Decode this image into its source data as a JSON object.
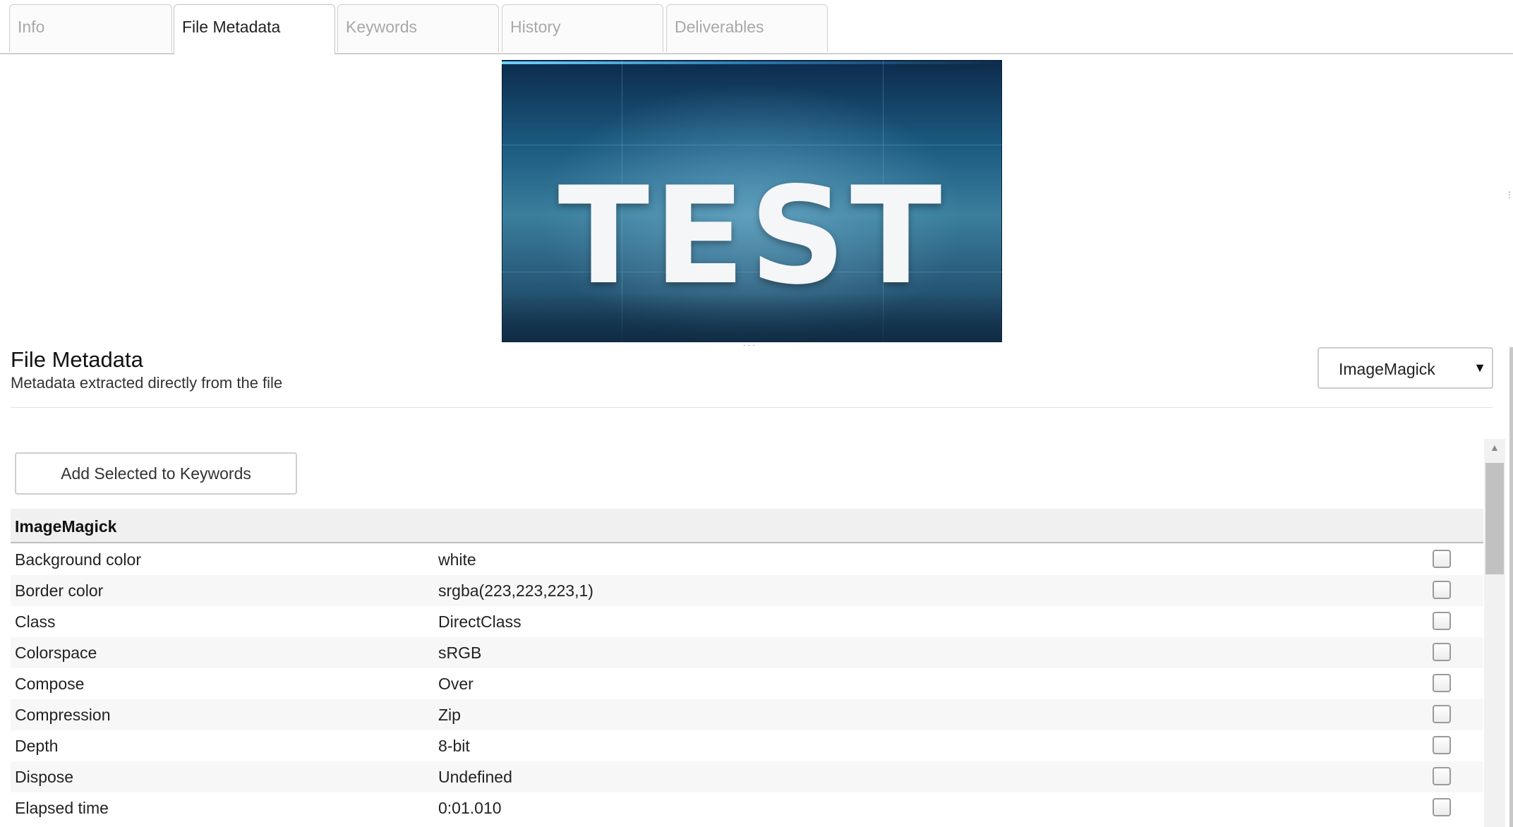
{
  "tabs": [
    {
      "label": "Info"
    },
    {
      "label": "File Metadata"
    },
    {
      "label": "Keywords"
    },
    {
      "label": "History"
    },
    {
      "label": "Deliverables"
    }
  ],
  "active_tab": "File Metadata",
  "preview": {
    "image_text": "TEST"
  },
  "section": {
    "title": "File Metadata",
    "subtitle": "Metadata extracted directly from the file"
  },
  "source_select": {
    "value": "ImageMagick"
  },
  "add_button": {
    "label": "Add Selected to Keywords"
  },
  "group": {
    "name": "ImageMagick"
  },
  "rows": [
    {
      "key": "Background color",
      "value": "white"
    },
    {
      "key": "Border color",
      "value": "srgba(223,223,223,1)"
    },
    {
      "key": "Class",
      "value": "DirectClass"
    },
    {
      "key": "Colorspace",
      "value": "sRGB"
    },
    {
      "key": "Compose",
      "value": "Over"
    },
    {
      "key": "Compression",
      "value": "Zip"
    },
    {
      "key": "Depth",
      "value": "8-bit"
    },
    {
      "key": "Dispose",
      "value": "Undefined"
    },
    {
      "key": "Elapsed time",
      "value": "0:01.010"
    }
  ]
}
